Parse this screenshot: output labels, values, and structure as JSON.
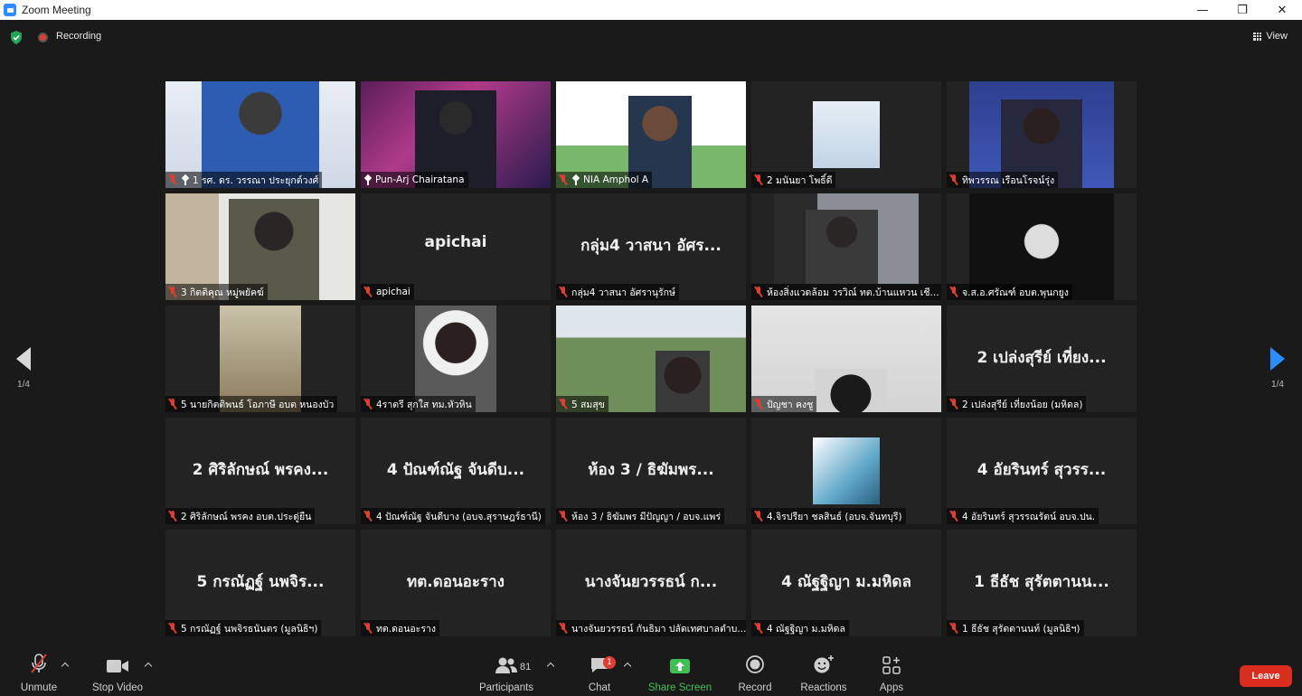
{
  "window": {
    "title": "Zoom Meeting",
    "minimize": "—",
    "maximize": "❐",
    "close": "✕"
  },
  "topbar": {
    "recording_label": "Recording",
    "view_label": "View"
  },
  "pagination": {
    "left": "1/4",
    "right": "1/4"
  },
  "tiles": [
    {
      "name": "1 รศ. ดร. วรรณา ประยุกต์วงศ์",
      "pinned": true,
      "muted": true,
      "big": ""
    },
    {
      "name": "Pun-Arj Chairatana",
      "pinned": true,
      "muted": false,
      "big": "",
      "active": true
    },
    {
      "name": "NIA Amphol A",
      "pinned": true,
      "muted": true,
      "big": ""
    },
    {
      "name": "2 มนันยา โพธิ์ดี",
      "pinned": false,
      "muted": true,
      "big": ""
    },
    {
      "name": "ทิพวรรณ เรือนโรจน์รุ่ง",
      "pinned": false,
      "muted": true,
      "big": ""
    },
    {
      "name": "3 กิตติคุณ หมู่พยัคฆ์",
      "pinned": false,
      "muted": true,
      "big": ""
    },
    {
      "name": "apichai",
      "pinned": false,
      "muted": true,
      "big": "apichai"
    },
    {
      "name": "กลุ่ม4 วาสนา อัศรานุรักษ์",
      "pinned": false,
      "muted": true,
      "big": "กลุ่ม4 วาสนา อัศร..."
    },
    {
      "name": "ห้องสิ่งแวดล้อม วรวิณ์ ทต.บ้านแหวน เชี...",
      "pinned": false,
      "muted": true,
      "big": ""
    },
    {
      "name": "จ.ส.อ.ศรัณฑ์ อบต.พุนกยูง",
      "pinned": false,
      "muted": true,
      "big": ""
    },
    {
      "name": "5 นายกิตติพนธ์ โอภาษี อบต หนองบัว",
      "pinned": false,
      "muted": true,
      "big": ""
    },
    {
      "name": "4ราตรี สุกใส ทม.หัวหิน",
      "pinned": false,
      "muted": true,
      "big": ""
    },
    {
      "name": "5 สมสุข",
      "pinned": false,
      "muted": true,
      "big": ""
    },
    {
      "name": "ปัญชา คงชู",
      "pinned": false,
      "muted": true,
      "big": ""
    },
    {
      "name": "2 เปล่งสุรีย์ เที่ยงน้อย (มหิดล)",
      "pinned": false,
      "muted": true,
      "big": "2 เปล่งสุรีย์ เที่ยง..."
    },
    {
      "name": "2 ศิริลักษณ์ พรคง อบต.ประดู่ยืน",
      "pinned": false,
      "muted": true,
      "big": "2 ศิริลักษณ์ พรคง..."
    },
    {
      "name": "4 ปัณฑ์ณัฐ จันดีบาง (อบจ.สุราษฎร์ธานี)",
      "pinned": false,
      "muted": true,
      "big": "4 ปัณฑ์ณัฐ จันดีบ..."
    },
    {
      "name": "ห้อง 3 / ธิฆัมพร มีปัญญา / อบจ.แพร่",
      "pinned": false,
      "muted": true,
      "big": "ห้อง 3 / ธิฆัมพร..."
    },
    {
      "name": "4.จิรปรียา ชลสินธ์ (อบจ.จันทบุรี)",
      "pinned": false,
      "muted": true,
      "big": ""
    },
    {
      "name": "4 อัยรินทร์ สุวรรณรัตน์ อบจ.ปน.",
      "pinned": false,
      "muted": true,
      "big": "4 อัยรินทร์ สุวรร..."
    },
    {
      "name": "5 กรณัฏฐ์ นพจิรธนันตร (มูลนิธิฯ)",
      "pinned": false,
      "muted": true,
      "big": "5 กรณัฏฐ์ นพจิร..."
    },
    {
      "name": "ทต.ดอนอะราง",
      "pinned": false,
      "muted": true,
      "big": "ทต.ดอนอะราง"
    },
    {
      "name": "นางจันยวรรธน์ กันธิมา ปลัดเทศบาลตำบ...",
      "pinned": false,
      "muted": true,
      "big": "นางจันยวรรธน์ ก..."
    },
    {
      "name": "4 ณัฐฐิญา ม.มหิดล",
      "pinned": false,
      "muted": true,
      "big": "4 ณัฐฐิญา ม.มหิดล"
    },
    {
      "name": "1 ธีธัช สุรัตตานนท์ (มูลนิธิฯ)",
      "pinned": false,
      "muted": true,
      "big": "1 ธีธัช สุรัตตานน..."
    }
  ],
  "toolbar": {
    "unmute": "Unmute",
    "stop_video": "Stop Video",
    "participants": "Participants",
    "participants_count": "81",
    "chat": "Chat",
    "chat_badge": "1",
    "share_screen": "Share Screen",
    "record": "Record",
    "reactions": "Reactions",
    "apps": "Apps",
    "leave": "Leave"
  },
  "colors": {
    "accent_blue": "#2d8cff",
    "leave_red": "#d92d20",
    "share_green": "#3fbf56",
    "active_speaker": "#e4e46a"
  }
}
